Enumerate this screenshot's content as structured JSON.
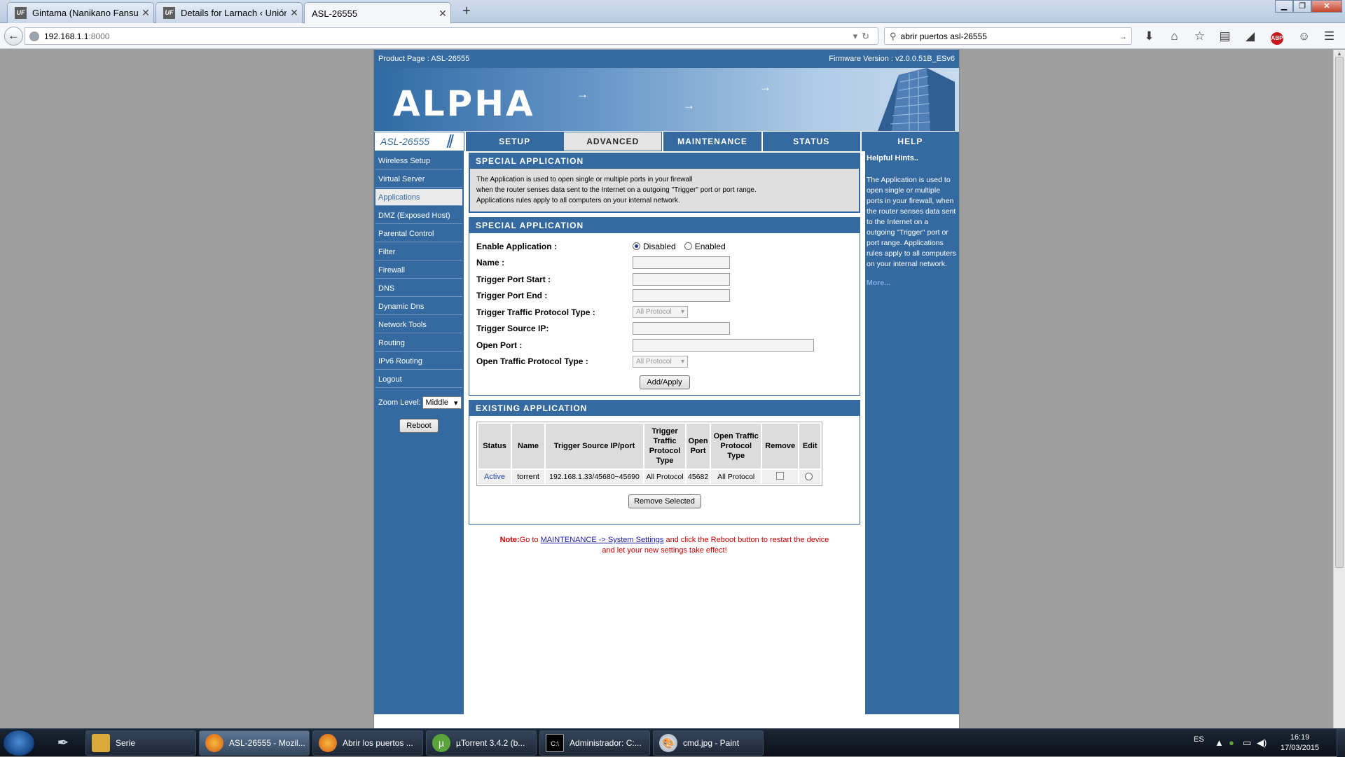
{
  "browser": {
    "tabs": [
      {
        "title": "Gintama (Nanikano Fansu...",
        "favicon": "UF",
        "active": false
      },
      {
        "title": "Details for Larnach ‹ Unión ...",
        "favicon": "UF",
        "active": false
      },
      {
        "title": "ASL-26555",
        "favicon": "",
        "active": true
      }
    ],
    "new_tab": "+",
    "url_host": "192.168.1.1",
    "url_port": ":8000",
    "search_text": "abrir puertos asl-26555",
    "toolbar_icons": [
      "download-icon",
      "home-icon",
      "bookmark-star-icon",
      "reading-list-icon",
      "send-icon",
      "adblock-icon",
      "chat-icon",
      "menu-icon"
    ],
    "adblock_label": "ABP"
  },
  "router": {
    "product_page": "Product Page : ASL-26555",
    "firmware": "Firmware Version : v2.0.0.51B_ESv6",
    "logo": "ALPHA",
    "model": "ASL-26555",
    "menu": [
      {
        "label": "SETUP",
        "selected": false
      },
      {
        "label": "ADVANCED",
        "selected": true
      },
      {
        "label": "MAINTENANCE",
        "selected": false
      },
      {
        "label": "STATUS",
        "selected": false
      },
      {
        "label": "HELP",
        "selected": false
      }
    ],
    "sidebar": [
      {
        "label": "Wireless Setup",
        "selected": false
      },
      {
        "label": "Virtual Server",
        "selected": false
      },
      {
        "label": "Applications",
        "selected": true
      },
      {
        "label": "DMZ (Exposed Host)",
        "selected": false
      },
      {
        "label": "Parental Control",
        "selected": false
      },
      {
        "label": "Filter",
        "selected": false
      },
      {
        "label": "Firewall",
        "selected": false
      },
      {
        "label": "DNS",
        "selected": false
      },
      {
        "label": "Dynamic Dns",
        "selected": false
      },
      {
        "label": "Network Tools",
        "selected": false
      },
      {
        "label": "Routing",
        "selected": false
      },
      {
        "label": "IPv6 Routing",
        "selected": false
      },
      {
        "label": "Logout",
        "selected": false
      }
    ],
    "zoom_label": "Zoom Level:",
    "zoom_value": "Middle",
    "reboot": "Reboot",
    "intro": {
      "title": "SPECIAL APPLICATION",
      "lines": [
        "The Application is used to open single or multiple ports in your firewall",
        "when the router senses data sent to the Internet on a outgoing \"Trigger\" port or port range.",
        "Applications rules apply to all computers on your internal network."
      ]
    },
    "form": {
      "title": "SPECIAL APPLICATION",
      "enable_label": "Enable Application :",
      "disabled_label": "Disabled",
      "enabled_label": "Enabled",
      "enable_state": "Disabled",
      "name_label": "Name :",
      "name_value": "",
      "trigger_start_label": "Trigger Port Start :",
      "trigger_start_value": "",
      "trigger_end_label": "Trigger Port End :",
      "trigger_end_value": "",
      "trigger_proto_label": "Trigger Traffic Protocol Type :",
      "trigger_proto_value": "All Protocol",
      "trigger_ip_label": "Trigger Source IP:",
      "trigger_ip_value": "",
      "open_port_label": "Open Port :",
      "open_port_value": "",
      "open_proto_label": "Open Traffic Protocol Type :",
      "open_proto_value": "All Protocol",
      "apply": "Add/Apply"
    },
    "existing": {
      "title": "EXISTING APPLICATION",
      "headers": [
        "Status",
        "Name",
        "Trigger Source IP/port",
        "Trigger Traffic Protocol Type",
        "Open Port",
        "Open Traffic Protocol Type",
        "Remove",
        "Edit"
      ],
      "rows": [
        {
          "status": "Active",
          "name": "torrent",
          "trigger": "192.168.1.33/45680~45690",
          "trigger_proto": "All Protocol",
          "open_port": "45682",
          "open_proto": "All Protocol",
          "remove": false,
          "edit": false
        }
      ],
      "remove_selected": "Remove Selected"
    },
    "note": {
      "prefix": "Note:",
      "text1": "Go to ",
      "link": "MAINTENANCE -> System Settings",
      "text2": " and click the Reboot button to restart the device",
      "line2": "and let your new settings take effect!"
    },
    "hints": {
      "title": "Helpful Hints..",
      "text": "The Application is used to open single or multiple ports in your firewall, when the router senses data sent to the Internet on a outgoing \"Trigger\" port or port range. Applications rules apply to all computers on your internal network.",
      "more": "More..."
    }
  },
  "taskbar": {
    "buttons": [
      {
        "label": "Serie",
        "icon": "folder-icon"
      },
      {
        "label": "ASL-26555 - Mozil...",
        "icon": "firefox-icon",
        "active": true
      },
      {
        "label": "Abrir los puertos ...",
        "icon": "firefox-icon"
      },
      {
        "label": "µTorrent 3.4.2  (b...",
        "icon": "utorrent-icon"
      },
      {
        "label": "Administrador: C:...",
        "icon": "cmd-icon"
      },
      {
        "label": "cmd.jpg - Paint",
        "icon": "paint-icon"
      }
    ],
    "lang": "ES",
    "time": "16:19",
    "date": "17/03/2015"
  },
  "colors": {
    "router_blue": "#356aa1",
    "note_red": "#cc0000"
  }
}
